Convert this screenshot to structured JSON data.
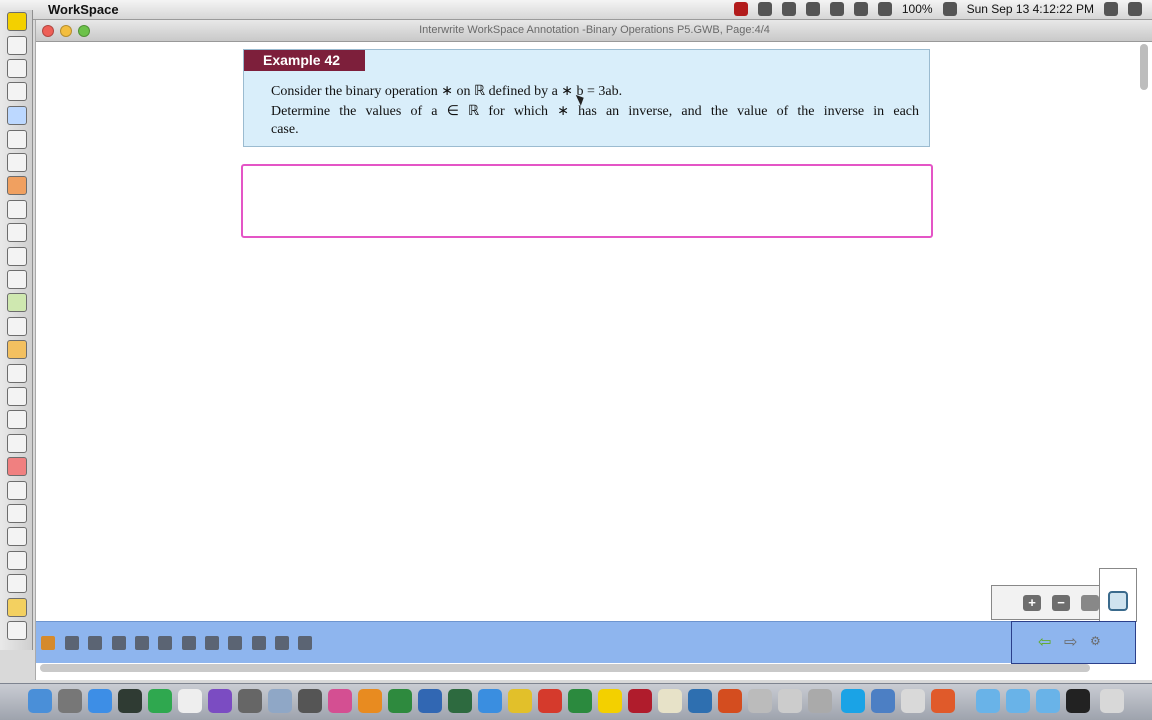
{
  "menubar": {
    "app_name": "WorkSpace",
    "battery": "100%",
    "clock": "Sun Sep 13  4:12:22 PM"
  },
  "window": {
    "title": "Interwrite WorkSpace Annotation -Binary Operations P5.GWB, Page:4/4"
  },
  "example": {
    "tag": "Example 42",
    "line1": "Consider the binary operation ∗ on ℝ defined by  a ∗ b = 3ab.",
    "line2": "Determine the values of  a ∈ ℝ  for which ∗ has an inverse, and the value of the inverse in each",
    "line3": "case."
  },
  "zoom": {
    "plus": "+",
    "minus": "−"
  },
  "colors": {
    "example_tag_bg": "#7d1f3b",
    "example_bg": "#d9eefa",
    "answer_border": "#e455c6",
    "bottombar_bg": "#8eb5ee"
  }
}
